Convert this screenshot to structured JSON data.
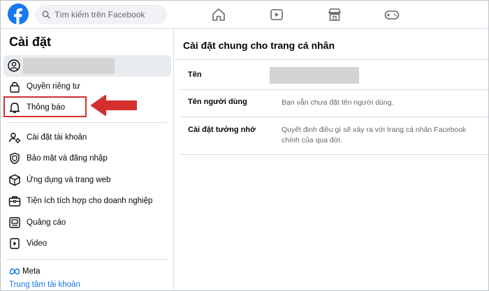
{
  "topbar": {
    "logo": "facebook-logo",
    "search_placeholder": "Tìm kiếm trên Facebook",
    "nav_icons": [
      "home-icon",
      "video-icon",
      "marketplace-icon",
      "gaming-icon"
    ]
  },
  "sidebar": {
    "title": "Cài đặt",
    "items": [
      {
        "label": "Quyền riêng tư",
        "icon": "lock-icon"
      },
      {
        "label": "Thông báo",
        "icon": "bell-icon"
      },
      {
        "label": "Cài đặt tài khoản",
        "icon": "account-settings-icon"
      },
      {
        "label": "Bảo mật và đăng nhập",
        "icon": "shield-icon"
      },
      {
        "label": "Ứng dụng và trang web",
        "icon": "cube-icon"
      },
      {
        "label": "Tiện ích tích hợp cho doanh nghiệp",
        "icon": "briefcase-icon"
      },
      {
        "label": "Quảng cáo",
        "icon": "ads-icon"
      },
      {
        "label": "Video",
        "icon": "video-play-icon"
      }
    ],
    "meta_brand": "Meta",
    "accounts_center": "Trung tâm tài khoản"
  },
  "main": {
    "title": "Cài đặt chung cho trang cá nhân",
    "rows": [
      {
        "label": "Tên",
        "value": ""
      },
      {
        "label": "Tên người dùng",
        "value": "Bạn vẫn chưa đặt tên người dùng."
      },
      {
        "label": "Cài đặt tưởng nhớ",
        "value": "Quyết định điều gì sẽ xảy ra với trang cá nhân Facebook chính của qua đời."
      }
    ]
  },
  "colors": {
    "brand": "#1877f2",
    "highlight": "#d32f2f"
  }
}
